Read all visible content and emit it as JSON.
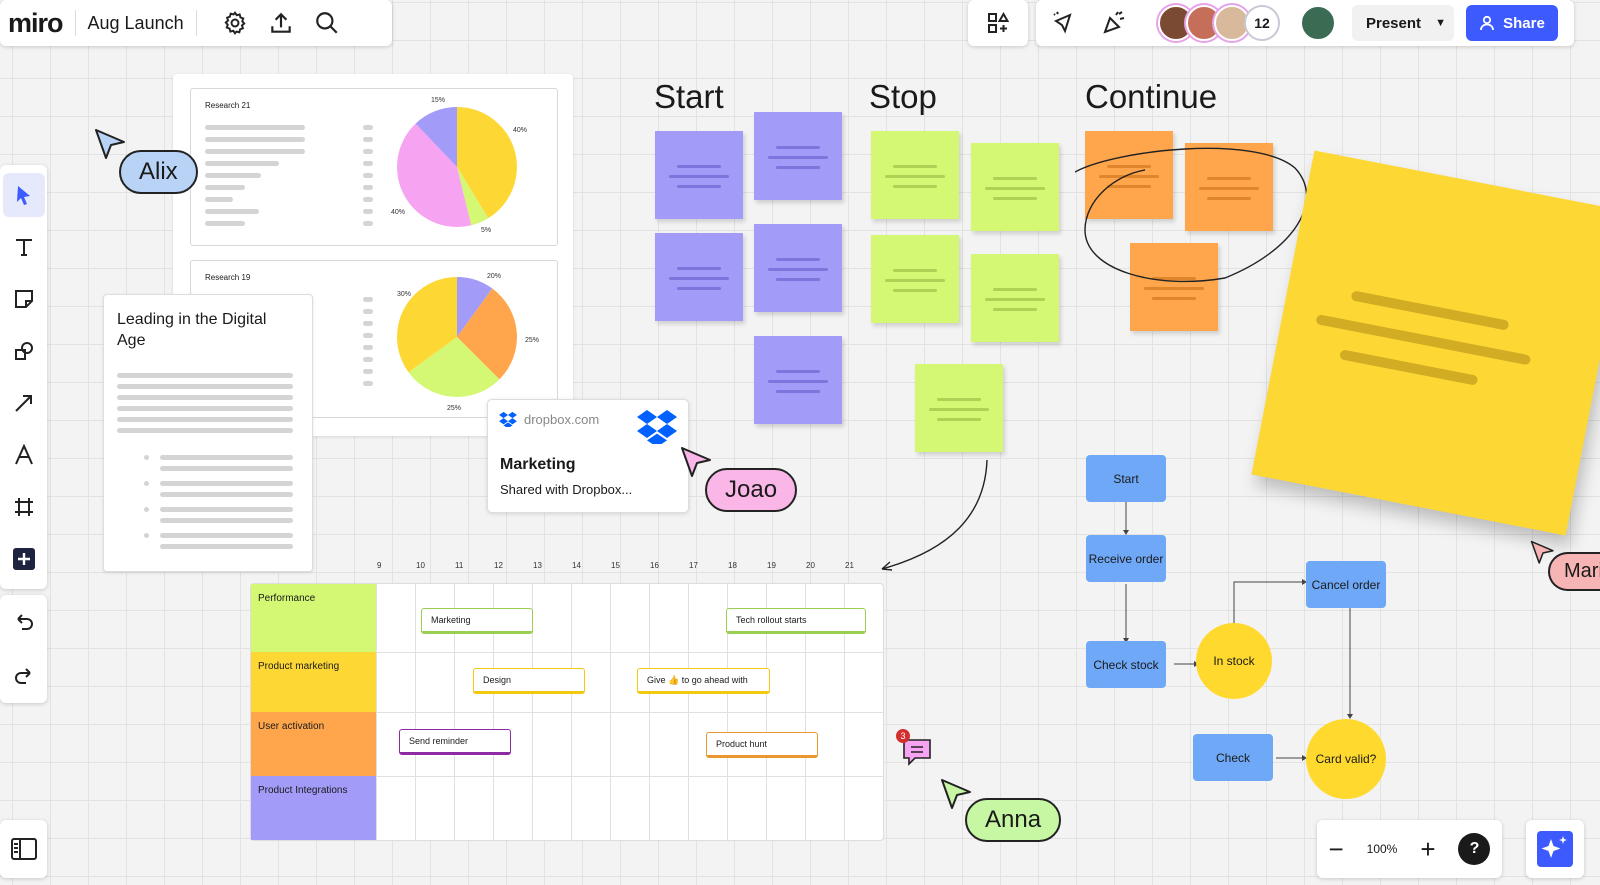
{
  "app": {
    "logo": "miro",
    "board_title": "Aug Launch"
  },
  "top_icons": [
    "gear-icon",
    "upload-icon",
    "search-icon"
  ],
  "left_toolbar": [
    "select-tool-icon",
    "text-tool-icon",
    "sticky-note-tool-icon",
    "shapes-tool-icon",
    "arrow-tool-icon",
    "pen-tool-icon",
    "frame-tool-icon",
    "add-more-icon"
  ],
  "history": [
    "undo-icon",
    "redo-icon"
  ],
  "collab": {
    "extra_count": "12",
    "present_label": "Present",
    "share_label": "Share"
  },
  "research": [
    {
      "title": "Research 21",
      "pie_labels": [
        "15%",
        "40%",
        "40%",
        "5%"
      ]
    },
    {
      "title": "Research 19",
      "pie_labels": [
        "30%",
        "20%",
        "25%",
        "25%"
      ]
    }
  ],
  "doc": {
    "title": "Leading in the Digital Age"
  },
  "dropbox": {
    "domain": "dropbox.com",
    "title": "Marketing",
    "subtitle": "Shared with Dropbox..."
  },
  "retro": {
    "start": "Start",
    "stop": "Stop",
    "continue": "Continue"
  },
  "cursors": {
    "alix": "Alix",
    "joao": "Joao",
    "anna": "Anna",
    "mari": "Mari"
  },
  "timeline": {
    "ticks": [
      "9",
      "10",
      "11",
      "12",
      "13",
      "14",
      "15",
      "16",
      "17",
      "18",
      "19",
      "20",
      "21"
    ],
    "rows": [
      "Performance",
      "Product marketing",
      "User activation",
      "Product Integrations"
    ],
    "cards": [
      "Marketing",
      "Tech rollout starts",
      "Design",
      "Give 👍 to go ahead with",
      "Send reminder",
      "Product hunt"
    ]
  },
  "comment_count": "3",
  "flow": {
    "start": "Start",
    "receive": "Receive order",
    "check_stock": "Check stock",
    "in_stock": "In stock",
    "cancel": "Cancel order",
    "check": "Check",
    "card_valid": "Card valid?"
  },
  "zoom": {
    "level": "100%",
    "help": "?"
  },
  "colors": {
    "accent": "#3d5afe",
    "purple_sticky": "#a39bf8",
    "green_sticky": "#d4f774",
    "orange_sticky": "#ffa64d",
    "yellow_sticky": "#fdd835",
    "flow_blue": "#6fa8f6",
    "flow_yellow": "#ffd92e"
  }
}
